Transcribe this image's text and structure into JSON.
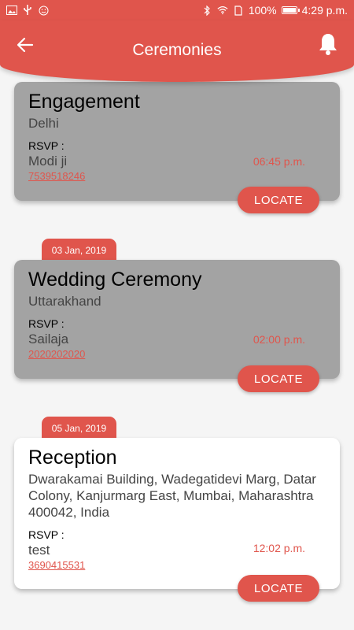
{
  "status_bar": {
    "battery": "100%",
    "time": "4:29 p.m."
  },
  "header": {
    "title": "Ceremonies",
    "back_icon": "arrow-left-icon",
    "notification_icon": "bell-icon"
  },
  "colors": {
    "primary": "#e0554c",
    "card_past": "#a3a3a3",
    "card_upcoming": "#ffffff"
  },
  "events": [
    {
      "date": "",
      "title": "Engagement",
      "location": "Delhi",
      "rsvp_label": "RSVP :",
      "rsvp_name": "Modi ji",
      "phone": "7539518246",
      "time": "06:45 p.m.",
      "button": "LOCATE"
    },
    {
      "date": "03 Jan, 2019",
      "title": "Wedding Ceremony",
      "location": "Uttarakhand",
      "rsvp_label": "RSVP :",
      "rsvp_name": "Sailaja",
      "phone": "2020202020",
      "time": "02:00 p.m.",
      "button": "LOCATE"
    },
    {
      "date": "05 Jan, 2019",
      "title": "Reception",
      "location": "Dwarakamai Building, Wadegatidevi Marg, Datar Colony, Kanjurmarg East, Mumbai, Maharashtra 400042, India",
      "rsvp_label": "RSVP :",
      "rsvp_name": "test",
      "phone": "3690415531",
      "time": "12:02 p.m.",
      "button": "LOCATE"
    }
  ]
}
